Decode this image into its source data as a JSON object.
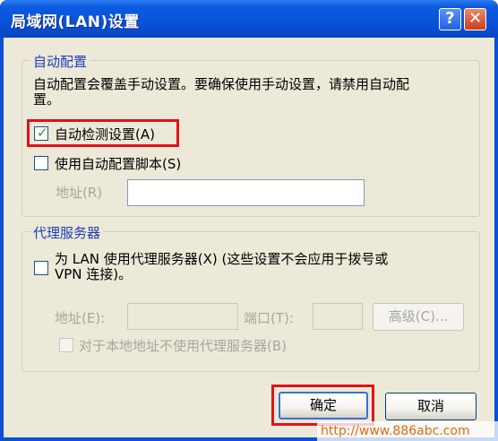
{
  "window": {
    "title": "局域网(LAN)设置",
    "help_glyph": "?",
    "close_glyph": "✕"
  },
  "auto_config": {
    "group_title": "自动配置",
    "description_line1": "自动配置会覆盖手动设置。要确保使用手动设置，请禁用自动配",
    "description_line2": "置。",
    "auto_detect": {
      "label": "自动检测设置(A)",
      "checked": true
    },
    "use_script": {
      "label": "使用自动配置脚本(S)",
      "checked": false
    },
    "address_label": "地址(R)",
    "address_value": ""
  },
  "proxy": {
    "group_title": "代理服务器",
    "use_proxy_line1": "为 LAN 使用代理服务器(X) (这些设置不会应用于拨号或",
    "use_proxy_line2": "VPN 连接)。",
    "address_label": "地址(E):",
    "address_value": "",
    "port_label": "端口(T):",
    "port_value": "",
    "advanced_label": "高级(C)...",
    "bypass_label": "对于本地地址不使用代理服务器(B)"
  },
  "buttons": {
    "ok": "确定",
    "cancel": "取消"
  },
  "watermark": "http://www.886abc.com",
  "colors": {
    "highlight": "#e0121a",
    "group_title": "#1c3fb8",
    "titlebar": "#0a52d8"
  }
}
